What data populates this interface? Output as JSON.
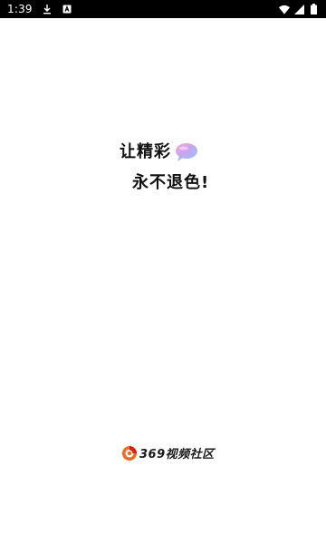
{
  "status_bar": {
    "time": "1:39",
    "icons": [
      "download-icon",
      "app-notification-icon",
      "wifi-icon",
      "signal-icon",
      "battery-icon"
    ]
  },
  "slogan": {
    "line1": "让精彩",
    "line2": "永不退色!",
    "icon": "speech-bubble-icon"
  },
  "brand": {
    "name": "369视频社区",
    "icon": "brand-logo-icon"
  }
}
